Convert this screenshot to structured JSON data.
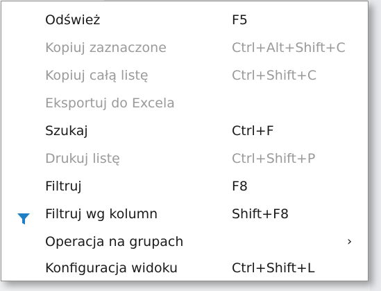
{
  "menu": {
    "items": [
      {
        "label": "Odśwież",
        "shortcut": "F5",
        "enabled": true
      },
      {
        "label": "Kopiuj zaznaczone",
        "shortcut": "Ctrl+Alt+Shift+C",
        "enabled": false
      },
      {
        "label": "Kopiuj całą listę",
        "shortcut": "Ctrl+Shift+C",
        "enabled": false
      },
      {
        "label": "Eksportuj do Excela",
        "shortcut": "",
        "enabled": false
      },
      {
        "label": "Szukaj",
        "shortcut": "Ctrl+F",
        "enabled": true
      },
      {
        "label": "Drukuj listę",
        "shortcut": "Ctrl+Shift+P",
        "enabled": false
      },
      {
        "label": "Filtruj",
        "shortcut": "F8",
        "enabled": true
      },
      {
        "label": "Filtruj wg kolumn",
        "shortcut": "Shift+F8",
        "enabled": true,
        "icon": "filter-icon",
        "icon_color": "#1e7fc6"
      },
      {
        "label": "Operacja na grupach",
        "shortcut": "",
        "enabled": true,
        "submenu_icon": "chevron-right-icon"
      },
      {
        "label": "Konfiguracja widoku",
        "shortcut": "Ctrl+Shift+L",
        "enabled": true
      }
    ]
  },
  "colors": {
    "text_enabled": "#1a1a1a",
    "text_disabled": "#9a9a9a",
    "menu_background": "#ffffff",
    "filter_icon": "#1e7fc6"
  }
}
